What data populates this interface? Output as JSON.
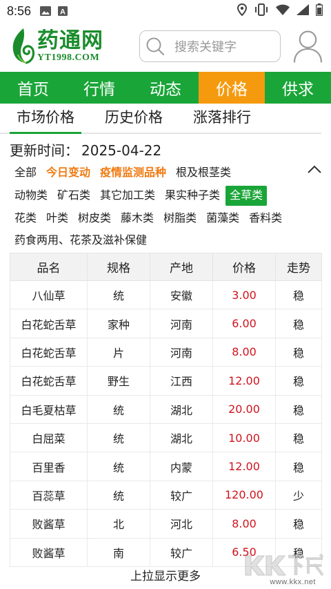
{
  "status_bar": {
    "time": "8:56",
    "icons_left": [
      "image-icon",
      "a-notification-icon"
    ],
    "icons_right": [
      "location-icon",
      "vibrate-icon",
      "wifi-icon",
      "signal-icon",
      "battery-icon"
    ]
  },
  "header": {
    "logo_name": "药通网",
    "logo_domain": "YT1998.COM",
    "search_placeholder": "搜索关键字"
  },
  "nav": {
    "items": [
      "首页",
      "行情",
      "动态",
      "价格",
      "供求"
    ],
    "active_index": 3
  },
  "subtabs": {
    "items": [
      "市场价格",
      "历史价格",
      "涨落排行"
    ],
    "active_index": 0
  },
  "update": {
    "label": "更新时间：",
    "date": "2025-04-22"
  },
  "categories": {
    "rows": [
      [
        "全部",
        "今日变动",
        "疫情监测品种",
        "根及根茎类"
      ],
      [
        "动物类",
        "矿石类",
        "其它加工类",
        "果实种子类",
        "全草类"
      ],
      [
        "花类",
        "叶类",
        "树皮类",
        "藤木类",
        "树脂类",
        "菌藻类",
        "香料类"
      ],
      [
        "药食两用、花茶及滋补保健"
      ]
    ],
    "highlighted": [
      "今日变动",
      "疫情监测品种"
    ],
    "selected": "全草类"
  },
  "table": {
    "headers": [
      "品名",
      "规格",
      "产地",
      "价格",
      "走势"
    ],
    "rows": [
      [
        "八仙草",
        "统",
        "安徽",
        "3.00",
        "稳"
      ],
      [
        "白花蛇舌草",
        "家种",
        "河南",
        "6.00",
        "稳"
      ],
      [
        "白花蛇舌草",
        "片",
        "河南",
        "8.00",
        "稳"
      ],
      [
        "白花蛇舌草",
        "野生",
        "江西",
        "12.00",
        "稳"
      ],
      [
        "白毛夏枯草",
        "统",
        "湖北",
        "20.00",
        "稳"
      ],
      [
        "白屈菜",
        "统",
        "湖北",
        "10.00",
        "稳"
      ],
      [
        "百里香",
        "统",
        "内蒙",
        "12.00",
        "稳"
      ],
      [
        "百蕊草",
        "统",
        "较广",
        "120.00",
        "少"
      ],
      [
        "败酱草",
        "北",
        "河北",
        "8.00",
        "稳"
      ],
      [
        "败酱草",
        "南",
        "较广",
        "6.50",
        "稳"
      ]
    ]
  },
  "load_more": "上拉显示更多",
  "watermark": {
    "brand": "KK下载",
    "site": "www.kkx.net"
  },
  "colors": {
    "green": "#1aa538",
    "orange": "#f59a0f",
    "hot_text": "#f07a12",
    "price_red": "#d0131e"
  }
}
